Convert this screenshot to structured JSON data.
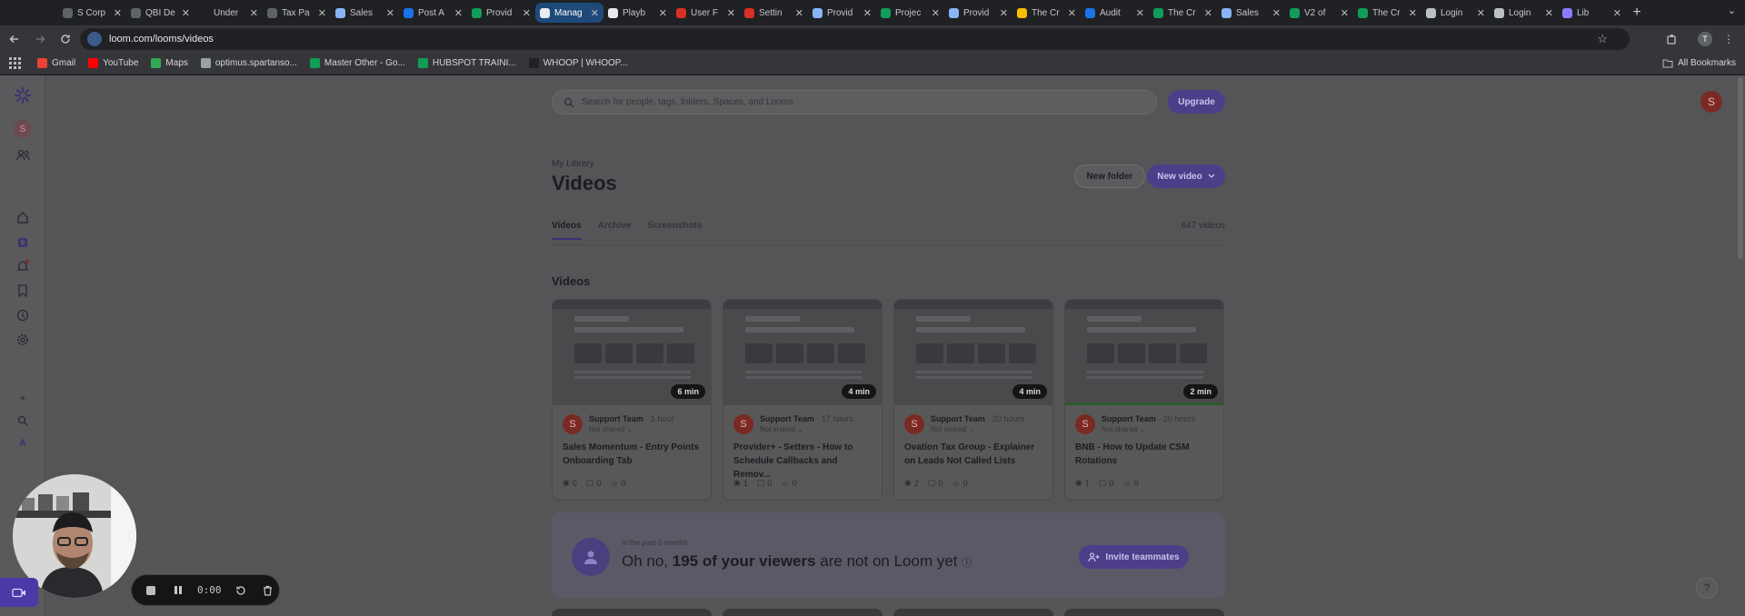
{
  "browser": {
    "tabs": [
      {
        "label": "S Corp",
        "color": "#5f6368"
      },
      {
        "label": "QBI De",
        "color": "#5f6368"
      },
      {
        "label": "Under",
        "color": "#202124"
      },
      {
        "label": "Tax Pa",
        "color": "#5f6368"
      },
      {
        "label": "Sales",
        "color": "#8ab4f8"
      },
      {
        "label": "Post A",
        "color": "#1a73e8"
      },
      {
        "label": "Provid",
        "color": "#0f9d58"
      },
      {
        "label": "Manag",
        "color": "#e8eaed",
        "active": true
      },
      {
        "label": "Playb",
        "color": "#e8eaed"
      },
      {
        "label": "User F",
        "color": "#d93025"
      },
      {
        "label": "Settin",
        "color": "#d93025"
      },
      {
        "label": "Provid",
        "color": "#8ab4f8"
      },
      {
        "label": "Projec",
        "color": "#0f9d58"
      },
      {
        "label": "Provid",
        "color": "#8ab4f8"
      },
      {
        "label": "The Cr",
        "color": "#fbbc04"
      },
      {
        "label": "Audit",
        "color": "#1a73e8"
      },
      {
        "label": "The Cr",
        "color": "#0f9d58"
      },
      {
        "label": "Sales",
        "color": "#8ab4f8"
      },
      {
        "label": "V2 of",
        "color": "#0f9d58"
      },
      {
        "label": "The Cr",
        "color": "#0f9d58"
      },
      {
        "label": "Login",
        "color": "#bdc1c6"
      },
      {
        "label": "Login",
        "color": "#bdc1c6"
      },
      {
        "label": "Lib",
        "color": "#8c7cff"
      }
    ],
    "new_tab_glyph": "+",
    "tabstrip_menu_glyph": "⌄",
    "url": "loom.com/looms/videos",
    "profile_initial": "T",
    "bookmarks": [
      {
        "label": "Gmail",
        "color": "#ea4335"
      },
      {
        "label": "YouTube",
        "color": "#ff0000"
      },
      {
        "label": "Maps",
        "color": "#34a853"
      },
      {
        "label": "optimus.spartanso...",
        "color": "#9aa0a6"
      },
      {
        "label": "Master Other - Go...",
        "color": "#0f9d58"
      },
      {
        "label": "HUBSPOT TRAINI...",
        "color": "#0f9d58"
      },
      {
        "label": "WHOOP | WHOOP...",
        "color": "#202124"
      }
    ],
    "all_bookmarks": "All Bookmarks"
  },
  "loom": {
    "rail_avatar": "S",
    "search_placeholder": "Search for people, tags, folders, Spaces, and Looms",
    "upgrade_label": "Upgrade",
    "user_initial": "S",
    "breadcrumb": "My Library",
    "title": "Videos",
    "new_folder_label": "New folder",
    "new_video_label": "New video",
    "tabs": [
      "Videos",
      "Archive",
      "Screenshots"
    ],
    "video_count": "647 videos",
    "section_title": "Videos",
    "videos": [
      {
        "duration": "6 min",
        "author": "Support Team",
        "age": "1 hour",
        "sharing": "Not shared",
        "title": "Sales Momentum - Entry Points Onboarding Tab",
        "views": "0",
        "comments": "0",
        "reactions": "0"
      },
      {
        "duration": "4 min",
        "author": "Support Team",
        "age": "17 hours",
        "sharing": "Not shared",
        "title": "Provider+ - Setters - How to Schedule Callbacks and Remov...",
        "views": "1",
        "comments": "0",
        "reactions": "0"
      },
      {
        "duration": "4 min",
        "author": "Support Team",
        "age": "20 hours",
        "sharing": "Not shared",
        "title": "Ovation Tax Group - Explainer on Leads Not Called Lists",
        "views": "2",
        "comments": "0",
        "reactions": "0"
      },
      {
        "duration": "2 min",
        "author": "Support Team",
        "age": "20 hours",
        "sharing": "Not shared",
        "title": "BNB - How to Update CSM Rotations",
        "views": "1",
        "comments": "0",
        "reactions": "0"
      }
    ],
    "banner": {
      "overline": "In the past 3 months",
      "msg_pre": "Oh no, ",
      "msg_bold": "195 of your viewers",
      "msg_post": " are not on Loom yet",
      "invite_label": "Invite teammates"
    },
    "help_glyph": "?"
  },
  "recording": {
    "timer": "0:00"
  }
}
